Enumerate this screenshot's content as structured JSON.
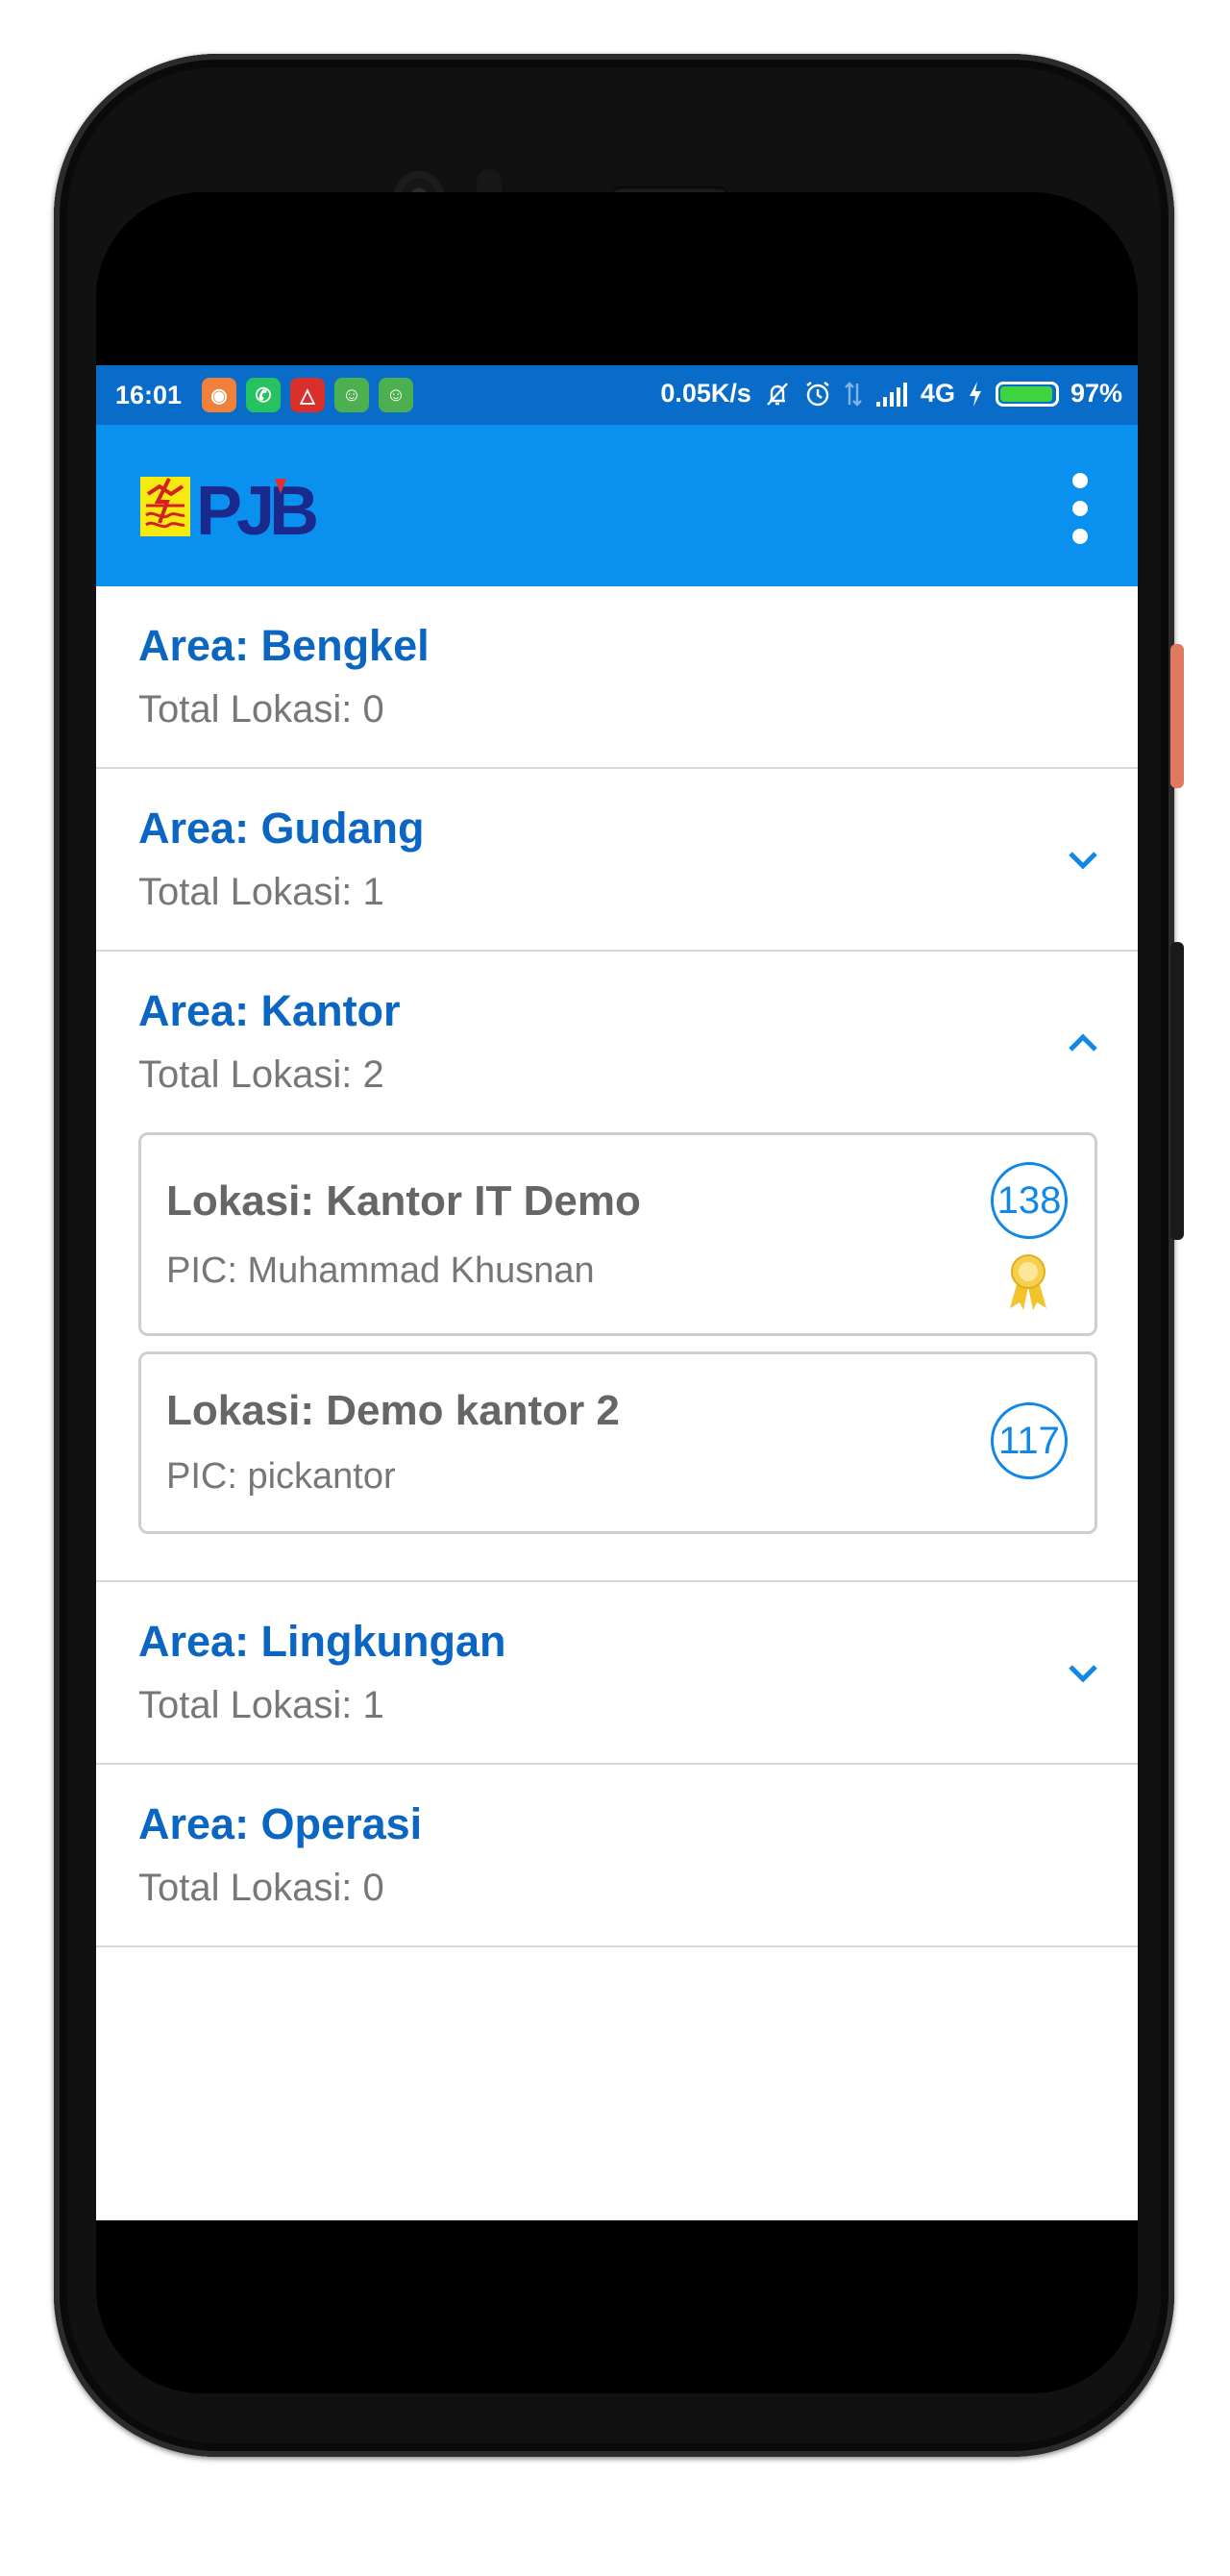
{
  "status_bar": {
    "time": "16:01",
    "speed": "0.05K/s",
    "network": "4G",
    "battery_level": 97,
    "battery": "97%",
    "notification_icons": [
      "cat-app-icon",
      "whatsapp-icon",
      "car-app-icon",
      "android-icon",
      "android-icon"
    ],
    "status_icons": [
      "muted-bell-icon",
      "alarm-icon",
      "data-arrows-icon",
      "signal-icon",
      "charging-icon"
    ]
  },
  "toolbar": {
    "logo_text": "PJB",
    "menu_icon": "more-vert-icon"
  },
  "colors": {
    "status_bar": "#0a6cc9",
    "toolbar": "#0a90ee",
    "area_title": "#0a66c2",
    "badge": "#1188e6"
  },
  "areas": [
    {
      "title": "Area: Bengkel",
      "count": "Total Lokasi: 0",
      "chevron": "none"
    },
    {
      "title": "Area: Gudang",
      "count": "Total Lokasi: 1",
      "chevron": "chevron-down-icon"
    },
    {
      "title": "Area: Kantor",
      "count": "Total Lokasi: 2",
      "chevron": "chevron-up-icon",
      "locations": [
        {
          "name": "Lokasi: Kantor IT Demo",
          "pic": "PIC: Muhammad Khusnan",
          "score": "138",
          "award_icon": "award-ribbon-icon"
        },
        {
          "name": "Lokasi: Demo kantor 2",
          "pic": "PIC: pickantor",
          "score": "117"
        }
      ]
    },
    {
      "title": "Area: Lingkungan",
      "count": "Total Lokasi: 1",
      "chevron": "chevron-down-icon"
    },
    {
      "title": "Area: Operasi",
      "count": "Total Lokasi: 0",
      "chevron": "none"
    }
  ]
}
